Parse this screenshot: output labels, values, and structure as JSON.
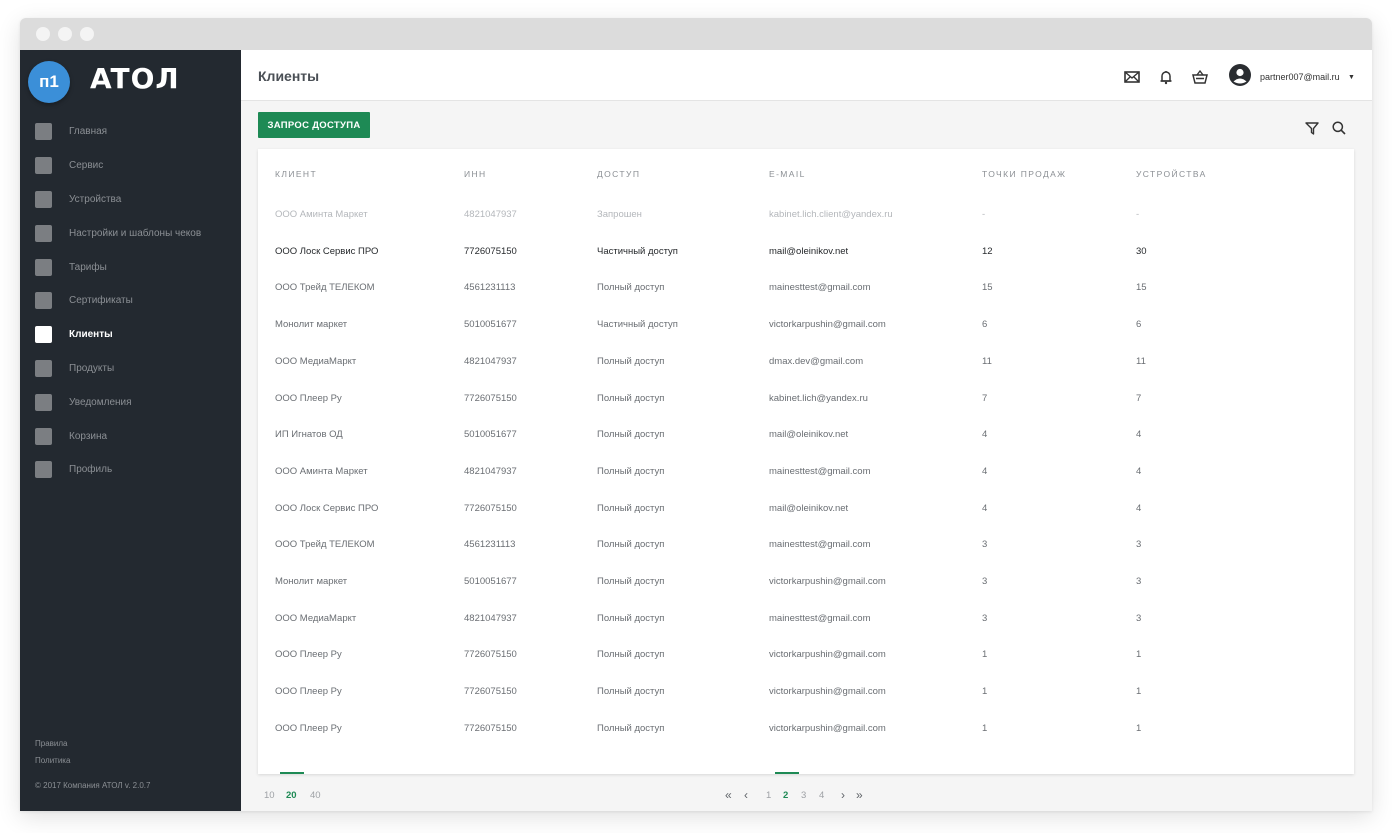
{
  "window": {
    "controls": [
      "close",
      "minimize",
      "maximize"
    ]
  },
  "sidebar": {
    "logo": "ATOЛ",
    "badge": "п1",
    "items": [
      {
        "label": "Главная",
        "active": false
      },
      {
        "label": "Сервис",
        "active": false
      },
      {
        "label": "Устройства",
        "active": false
      },
      {
        "label": "Настройки и шаблоны чеков",
        "active": false
      },
      {
        "label": "Тарифы",
        "active": false
      },
      {
        "label": "Сертификаты",
        "active": false
      },
      {
        "label": "Клиенты",
        "active": true
      },
      {
        "label": "Продукты",
        "active": false
      },
      {
        "label": "Уведомления",
        "active": false
      },
      {
        "label": "Корзина",
        "active": false
      },
      {
        "label": "Профиль",
        "active": false
      }
    ],
    "footer": {
      "rules": "Правила",
      "policy": "Политика",
      "copyright": "© 2017 Компания АТОЛ  v. 2.0.7"
    }
  },
  "header": {
    "title": "Клиенты",
    "icons": [
      "mail-icon",
      "bell-icon",
      "basket-icon"
    ],
    "user_email": "partner007@mail.ru",
    "caret": "▼"
  },
  "toolbar": {
    "request_access_label": "ЗАПРОС ДОСТУПА",
    "icons": [
      "filter-icon",
      "search-icon"
    ]
  },
  "table": {
    "columns": [
      "КЛИЕНТ",
      "ИНН",
      "ДОСТУП",
      "E-MAIL",
      "ТОЧКИ ПРОДАЖ",
      "УСТРОЙСТВА"
    ],
    "rows": [
      {
        "client": "ООО Аминта Маркет",
        "inn": "4821047937",
        "access": "Запрошен",
        "email": "kabinet.lich.client@yandex.ru",
        "points": "-",
        "devices": "-",
        "state": "pending"
      },
      {
        "client": "ООО Лоск Сервис ПРО",
        "inn": "7726075150",
        "access": "Частичный доступ",
        "email": "mail@oleinikov.net",
        "points": "12",
        "devices": "30",
        "state": "bold"
      },
      {
        "client": "ООО Трейд ТЕЛЕКОМ",
        "inn": "4561231113",
        "access": "Полный доступ",
        "email": "mainesttest@gmail.com",
        "points": "15",
        "devices": "15",
        "state": "normal"
      },
      {
        "client": "Монолит маркет",
        "inn": "5010051677",
        "access": "Частичный доступ",
        "email": "victorkarpushin@gmail.com",
        "points": "6",
        "devices": "6",
        "state": "normal"
      },
      {
        "client": "ООО МедиаМаркт",
        "inn": "4821047937",
        "access": "Полный доступ",
        "email": "dmax.dev@gmail.com",
        "points": "11",
        "devices": "11",
        "state": "normal"
      },
      {
        "client": "ООО Плеер Ру",
        "inn": "7726075150",
        "access": "Полный доступ",
        "email": "kabinet.lich@yandex.ru",
        "points": "7",
        "devices": "7",
        "state": "normal"
      },
      {
        "client": "ИП Игнатов ОД",
        "inn": "5010051677",
        "access": "Полный доступ",
        "email": "mail@oleinikov.net",
        "points": "4",
        "devices": "4",
        "state": "normal"
      },
      {
        "client": "ООО Аминта Маркет",
        "inn": "4821047937",
        "access": "Полный доступ",
        "email": "mainesttest@gmail.com",
        "points": "4",
        "devices": "4",
        "state": "normal"
      },
      {
        "client": "ООО Лоск Сервис ПРО",
        "inn": "7726075150",
        "access": "Полный доступ",
        "email": "mail@oleinikov.net",
        "points": "4",
        "devices": "4",
        "state": "normal"
      },
      {
        "client": "ООО Трейд ТЕЛЕКОМ",
        "inn": "4561231113",
        "access": "Полный доступ",
        "email": "mainesttest@gmail.com",
        "points": "3",
        "devices": "3",
        "state": "normal"
      },
      {
        "client": "Монолит маркет",
        "inn": "5010051677",
        "access": "Полный доступ",
        "email": "victorkarpushin@gmail.com",
        "points": "3",
        "devices": "3",
        "state": "normal"
      },
      {
        "client": "ООО МедиаМаркт",
        "inn": "4821047937",
        "access": "Полный доступ",
        "email": "mainesttest@gmail.com",
        "points": "3",
        "devices": "3",
        "state": "normal"
      },
      {
        "client": "ООО Плеер Ру",
        "inn": "7726075150",
        "access": "Полный доступ",
        "email": "victorkarpushin@gmail.com",
        "points": "1",
        "devices": "1",
        "state": "normal"
      },
      {
        "client": "ООО Плеер Ру",
        "inn": "7726075150",
        "access": "Полный доступ",
        "email": "victorkarpushin@gmail.com",
        "points": "1",
        "devices": "1",
        "state": "normal"
      },
      {
        "client": "ООО Плеер Ру",
        "inn": "7726075150",
        "access": "Полный доступ",
        "email": "victorkarpushin@gmail.com",
        "points": "1",
        "devices": "1",
        "state": "normal"
      }
    ]
  },
  "pagination": {
    "page_sizes": [
      "10",
      "20",
      "40"
    ],
    "active_page_size": "20",
    "first": "«",
    "prev": "‹",
    "pages": [
      "1",
      "2",
      "3",
      "4"
    ],
    "active_page": "2",
    "next": "›",
    "last": "»"
  },
  "colors": {
    "accent": "#1e8a55",
    "sidebar_bg": "#232930",
    "badge": "#3b8fd8"
  }
}
